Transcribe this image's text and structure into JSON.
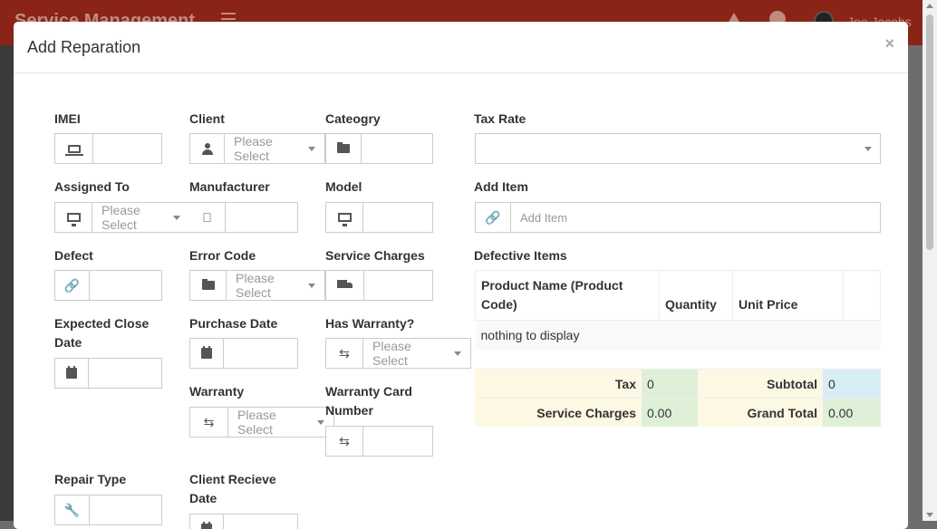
{
  "app": {
    "title": "Service Management",
    "user": "Joe Jacobs"
  },
  "modal": {
    "title": "Add Reparation",
    "close": "×"
  },
  "fields": {
    "imei": {
      "label": "IMEI",
      "value": ""
    },
    "client": {
      "label": "Client",
      "placeholder": "Please Select"
    },
    "category": {
      "label": "Cateogry",
      "value": ""
    },
    "tax_rate": {
      "label": "Tax Rate",
      "value": ""
    },
    "assigned_to": {
      "label": "Assigned To",
      "placeholder": "Please Select"
    },
    "manufacturer": {
      "label": "Manufacturer",
      "value": ""
    },
    "model": {
      "label": "Model",
      "value": ""
    },
    "add_item": {
      "label": "Add Item",
      "placeholder": "Add Item"
    },
    "defect": {
      "label": "Defect",
      "value": ""
    },
    "error_code": {
      "label": "Error Code",
      "placeholder": "Please Select"
    },
    "service_charges": {
      "label": "Service Charges",
      "value": ""
    },
    "expected_close_date": {
      "label": "Expected Close Date",
      "value": ""
    },
    "purchase_date": {
      "label": "Purchase Date",
      "value": ""
    },
    "has_warranty": {
      "label": "Has Warranty?",
      "placeholder": "Please Select"
    },
    "warranty": {
      "label": "Warranty",
      "placeholder": "Please Select"
    },
    "warranty_card_number": {
      "label": "Warranty Card Number",
      "value": ""
    },
    "repair_type": {
      "label": "Repair Type",
      "value": ""
    },
    "client_recieve_date": {
      "label": "Client Recieve Date",
      "value": ""
    }
  },
  "defective_items": {
    "label": "Defective Items",
    "columns": [
      "Product Name (Product Code)",
      "Quantity",
      "Unit Price",
      ""
    ],
    "empty_text": "nothing to display"
  },
  "totals": {
    "tax_label": "Tax",
    "tax_value": "0",
    "subtotal_label": "Subtotal",
    "subtotal_value": "0",
    "service_charges_label": "Service Charges",
    "service_charges_value": "0.00",
    "grand_total_label": "Grand Total",
    "grand_total_value": "0.00"
  },
  "icons": {
    "imei": "laptop-icon",
    "client": "user-icon",
    "category": "folder-icon",
    "assigned_to": "monitor-icon",
    "manufacturer": "apple-icon",
    "model": "monitor-icon",
    "add_item": "link-icon",
    "defect": "link-icon",
    "error_code": "folder-icon",
    "service_charges": "truck-icon",
    "expected_close_date": "calendar-icon",
    "purchase_date": "calendar-icon",
    "has_warranty": "retweet-icon",
    "warranty": "retweet-icon",
    "warranty_card_number": "retweet-icon",
    "repair_type": "wrench-icon",
    "client_recieve_date": "calendar-icon"
  },
  "colors": {
    "header_bg": "#8a2417",
    "tax_bg": "#fcf8e3",
    "value_green": "#dff0d8",
    "value_blue": "#d9edf7"
  }
}
